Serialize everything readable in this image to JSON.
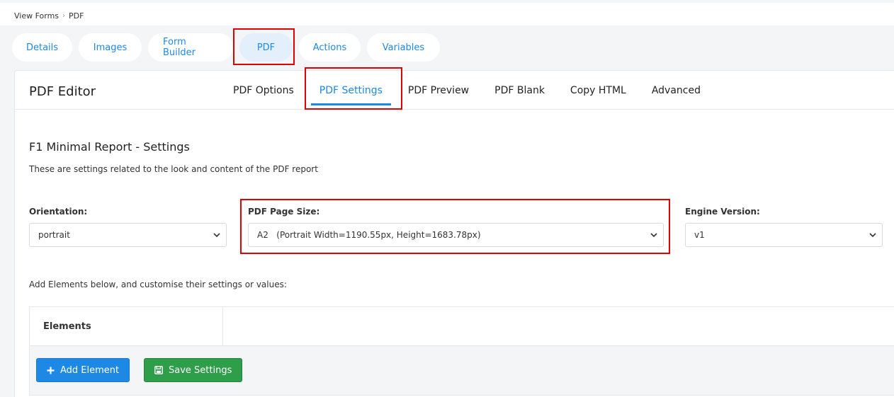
{
  "breadcrumb": {
    "items": [
      "View Forms",
      "PDF"
    ],
    "separator": "›"
  },
  "top_tabs": [
    "Details",
    "Images",
    "Form Builder",
    "PDF",
    "Actions",
    "Variables"
  ],
  "editor": {
    "title": "PDF Editor",
    "tabs": [
      "PDF Options",
      "PDF Settings",
      "PDF Preview",
      "PDF Blank",
      "Copy HTML",
      "Advanced"
    ]
  },
  "settings": {
    "title": "F1 Minimal Report - Settings",
    "description": "These are settings related to the look and content of the PDF report",
    "orientation": {
      "label": "Orientation:",
      "value": "portrait"
    },
    "page_size": {
      "label": "PDF Page Size:",
      "value": "A2   (Portrait Width=1190.55px, Height=1683.78px)"
    },
    "engine": {
      "label": "Engine Version:",
      "value": "v1"
    }
  },
  "elements": {
    "intro": "Add Elements below, and customise their settings or values:",
    "header": "Elements",
    "add_button": "Add Element",
    "save_button": "Save Settings"
  },
  "colors": {
    "accent": "#1e88e5",
    "success": "#2e9e4a",
    "highlight": "#e00000"
  }
}
